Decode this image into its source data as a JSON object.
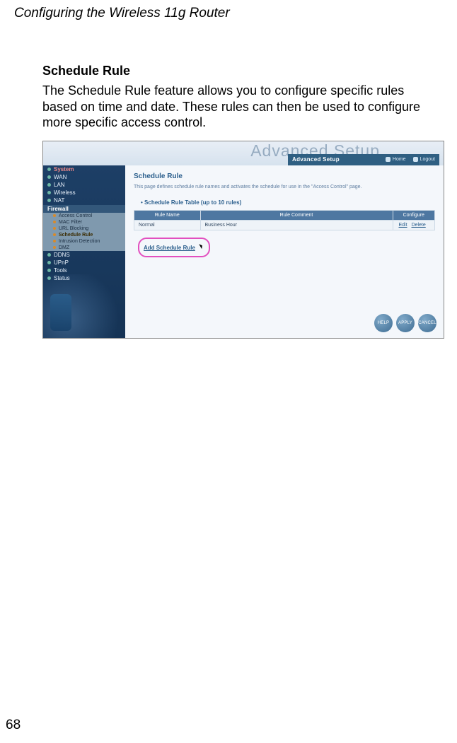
{
  "page": {
    "running_head": "Configuring the Wireless 11g Router",
    "number": "68"
  },
  "section": {
    "title": "Schedule Rule",
    "paragraph": "The Schedule Rule feature allows you to configure specific rules based on time and date. These rules can then be used to configure more specific access control."
  },
  "router": {
    "header": {
      "ghost": "Advanced Setup",
      "tab_label": "Advanced Setup",
      "home": "Home",
      "logout": "Logout"
    },
    "sidebar": {
      "items": [
        {
          "label": "System",
          "cls": "system"
        },
        {
          "label": "WAN"
        },
        {
          "label": "LAN"
        },
        {
          "label": "Wireless"
        },
        {
          "label": "NAT"
        }
      ],
      "firewall_label": "Firewall",
      "firewall_sub": [
        {
          "label": "Access Control"
        },
        {
          "label": "MAC Filter"
        },
        {
          "label": "URL Blocking"
        },
        {
          "label": "Schedule Rule",
          "active": true
        },
        {
          "label": "Intrusion Detection"
        },
        {
          "label": "DMZ"
        }
      ],
      "tail": [
        {
          "label": "DDNS"
        },
        {
          "label": "UPnP"
        },
        {
          "label": "Tools"
        },
        {
          "label": "Status"
        }
      ]
    },
    "content": {
      "heading": "Schedule Rule",
      "desc": "This page defines schedule rule names and activates the schedule for use in the \"Access Control\" page.",
      "table_caption": "Schedule Rule Table (up to 10 rules)",
      "columns": {
        "name": "Rule Name",
        "comment": "Rule Comment",
        "configure": "Configure"
      },
      "rows": [
        {
          "name": "Normal",
          "comment": "Business Hour",
          "edit": "Edit",
          "delete": "Delete"
        }
      ],
      "add_label": "Add Schedule Rule"
    },
    "footer": {
      "help": "HELP",
      "apply": "APPLY",
      "cancel": "CANCEL"
    }
  }
}
